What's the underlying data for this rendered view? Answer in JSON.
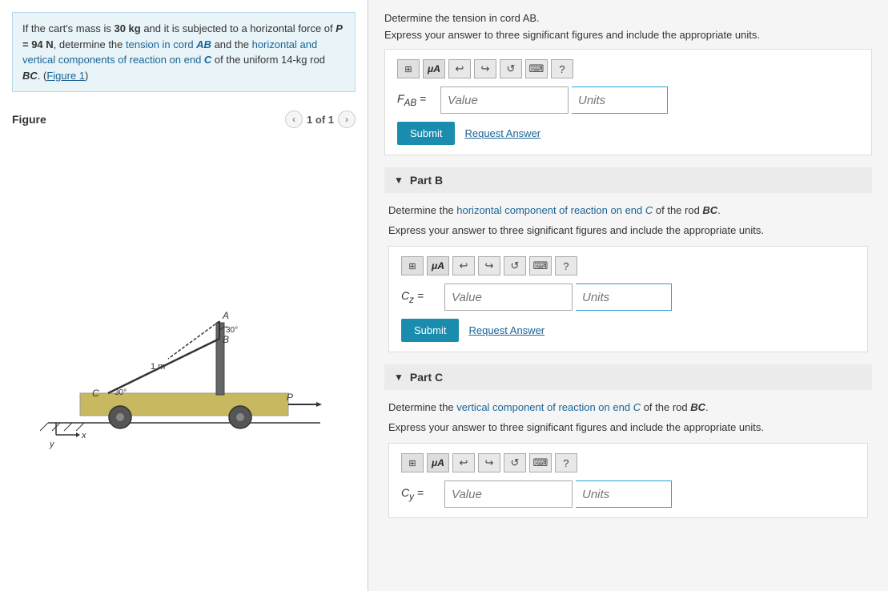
{
  "left": {
    "problem_text": "If the cart's mass is 30 kg and it is subjected to a horizontal force of P = 94 N, determine the tension in cord AB and the horizontal and vertical components of reaction on end C of the uniform 14-kg rod BC. (Figure 1)",
    "figure_label": "Figure",
    "figure_nav": "1 of 1",
    "highlight_words": [
      "tension in cord AB",
      "horizontal and vertical components",
      "end C",
      "rod BC"
    ]
  },
  "right": {
    "top_instruction_1": "Determine the tension in cord AB.",
    "top_instruction_2": "Express your answer to three significant figures and include the appropriate units.",
    "partA": {
      "label_text": "F",
      "label_sub": "AB",
      "label_eq": "=",
      "value_placeholder": "Value",
      "units_placeholder": "Units",
      "submit_label": "Submit",
      "request_label": "Request Answer"
    },
    "partB": {
      "header": "Part B",
      "instruction_1": "Determine the horizontal component of reaction on end C of the rod BC.",
      "instruction_2": "Express your answer to three significant figures and include the appropriate units.",
      "label_text": "C",
      "label_sub": "z",
      "label_eq": "=",
      "value_placeholder": "Value",
      "units_placeholder": "Units",
      "submit_label": "Submit",
      "request_label": "Request Answer"
    },
    "partC": {
      "header": "Part C",
      "instruction_1": "Determine the vertical component of reaction on end C of the rod BC.",
      "instruction_2": "Express your answer to three significant figures and include the appropriate units.",
      "label_text": "C",
      "label_sub": "y",
      "label_eq": "=",
      "value_placeholder": "Value",
      "units_placeholder": "Units",
      "submit_label": "Submit",
      "request_label": "Request Answer"
    },
    "toolbar": {
      "grid_icon": "⊞",
      "mu_label": "μA",
      "undo_icon": "↩",
      "redo_icon": "↪",
      "refresh_icon": "↺",
      "keyboard_icon": "⌨",
      "help_icon": "?"
    }
  }
}
